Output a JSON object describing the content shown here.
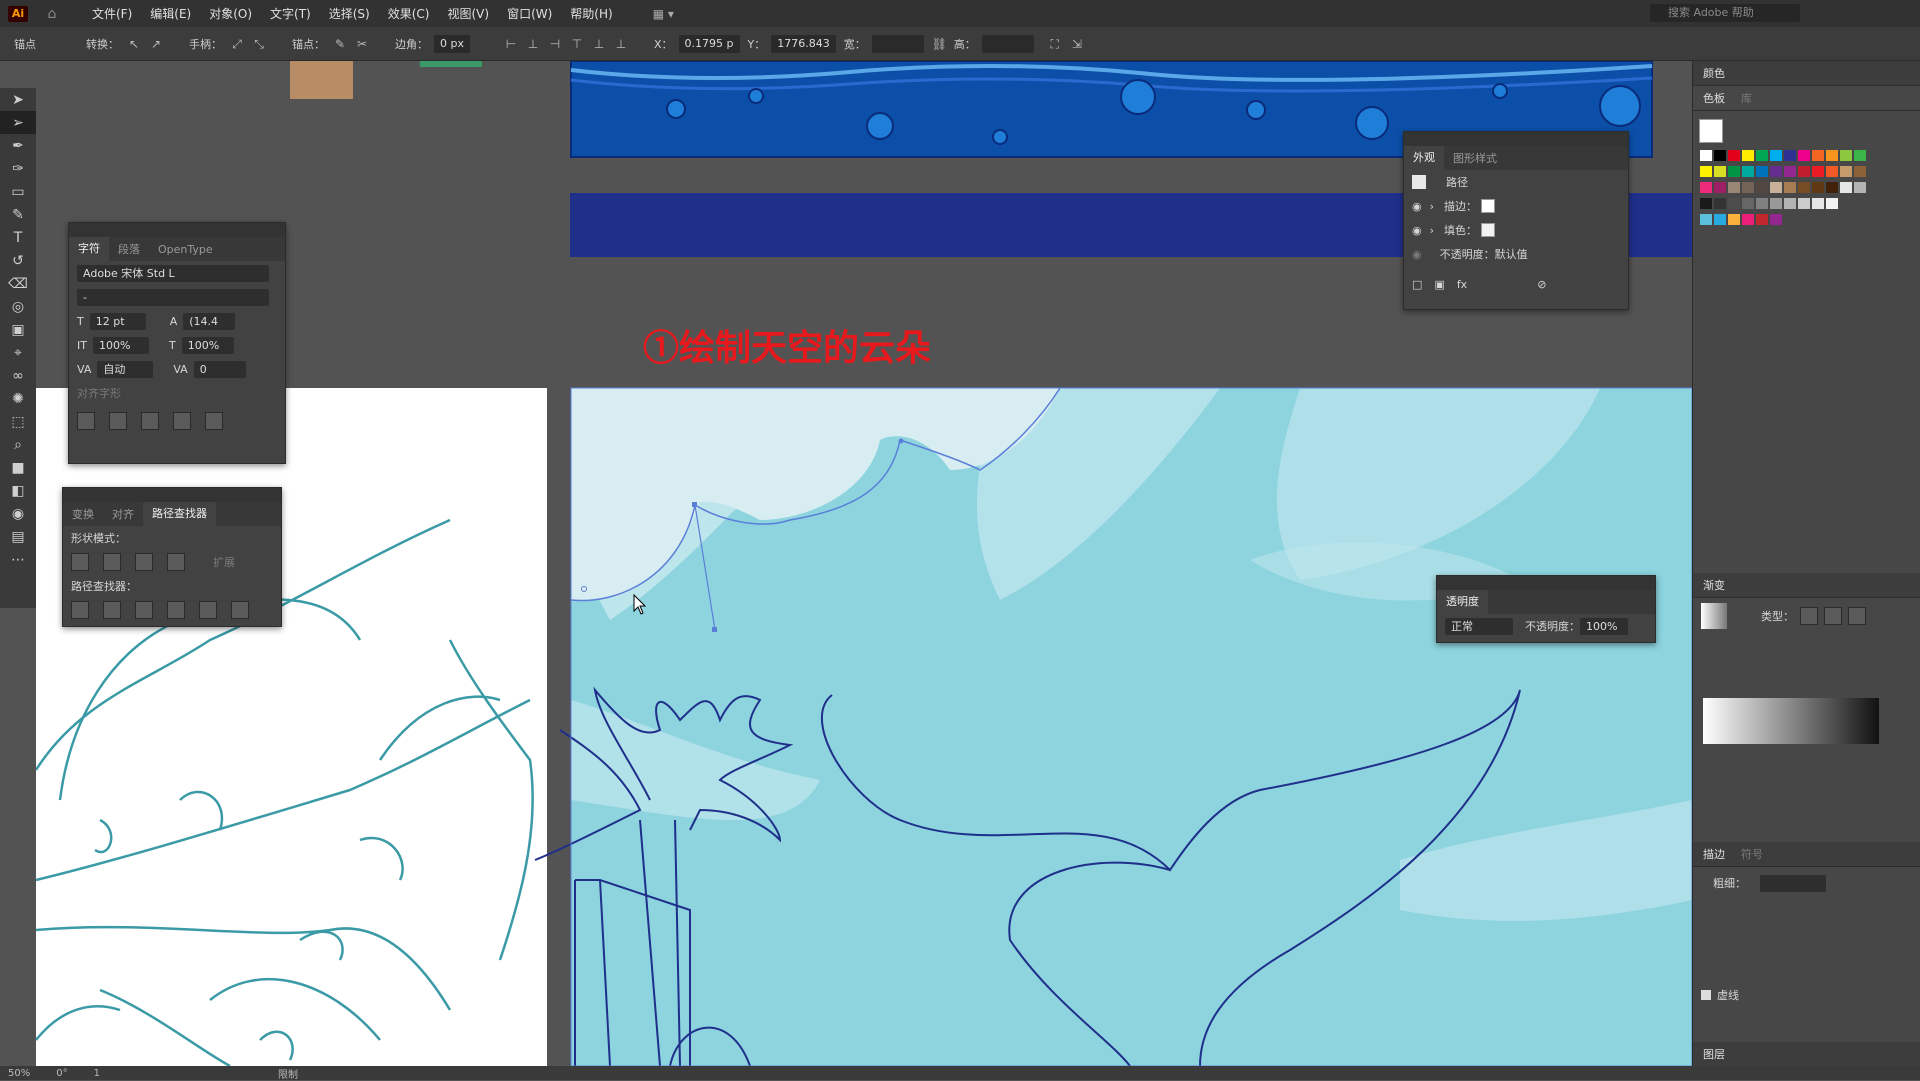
{
  "app": {
    "logo": "Ai",
    "home_icon": "home-icon"
  },
  "menu": [
    "文件(F)",
    "编辑(E)",
    "对象(O)",
    "文字(T)",
    "选择(S)",
    "效果(C)",
    "视图(V)",
    "窗口(W)",
    "帮助(H)"
  ],
  "search": {
    "placeholder": "搜索 Adobe 帮助"
  },
  "controlbar": {
    "anchor_label": "锚点",
    "convert_label": "转换：",
    "handle_label": "手柄：",
    "anchor2_label": "锚点：",
    "corner_label": "边角：",
    "corner_value": "0 px",
    "x_label": "X：",
    "x_value": "0.1795 p",
    "y_label": "Y：",
    "y_value": "1776.843",
    "w_label": "宽：",
    "h_label": "高："
  },
  "character_panel": {
    "tabs": [
      "字符",
      "段落",
      "OpenType"
    ],
    "font_family": "Adobe 宋体 Std L",
    "font_style": "-",
    "font_size": "12 pt",
    "leading": "(14.4",
    "vscale": "100%",
    "hscale": "100%",
    "kerning": "自动",
    "tracking": "0",
    "align_glyph_label": "对齐字形"
  },
  "pathfinder_panel": {
    "tabs": [
      "变换",
      "对齐",
      "路径查找器"
    ],
    "shape_modes_label": "形状模式：",
    "expand_label": "扩展",
    "pathfinders_label": "路径查找器："
  },
  "appearance_panel": {
    "tabs": [
      "外观",
      "图形样式"
    ],
    "object": "路径",
    "stroke_label": "描边：",
    "fill_label": "填色：",
    "opacity_label": "不透明度：",
    "opacity_value": "默认值"
  },
  "transparency_panel": {
    "title": "透明度",
    "mode": "正常",
    "opacity_label": "不透明度：",
    "opacity_value": "100%"
  },
  "annotation": {
    "text": "①绘制天空的云朵"
  },
  "right_dock": {
    "color_tab": "颜色",
    "swatch_tabs": [
      "色板",
      "库"
    ],
    "gradient_tab": "渐变",
    "gradient_type_label": "类型：",
    "stroke_tabs": [
      "描边",
      "符号"
    ],
    "weight_label": "粗细：",
    "dashed_label": "虚线",
    "layers_tab": "图层"
  },
  "statusbar": {
    "zoom": "50%",
    "rotation": "0°",
    "artboard": "1",
    "tool": "限制"
  },
  "colors": {
    "sky": "#8dd4df",
    "deep_blue": "#0c4fa8",
    "navy": "#1f2f8a",
    "sketch": "#3a9aa6",
    "annotation": "#e8191d"
  }
}
